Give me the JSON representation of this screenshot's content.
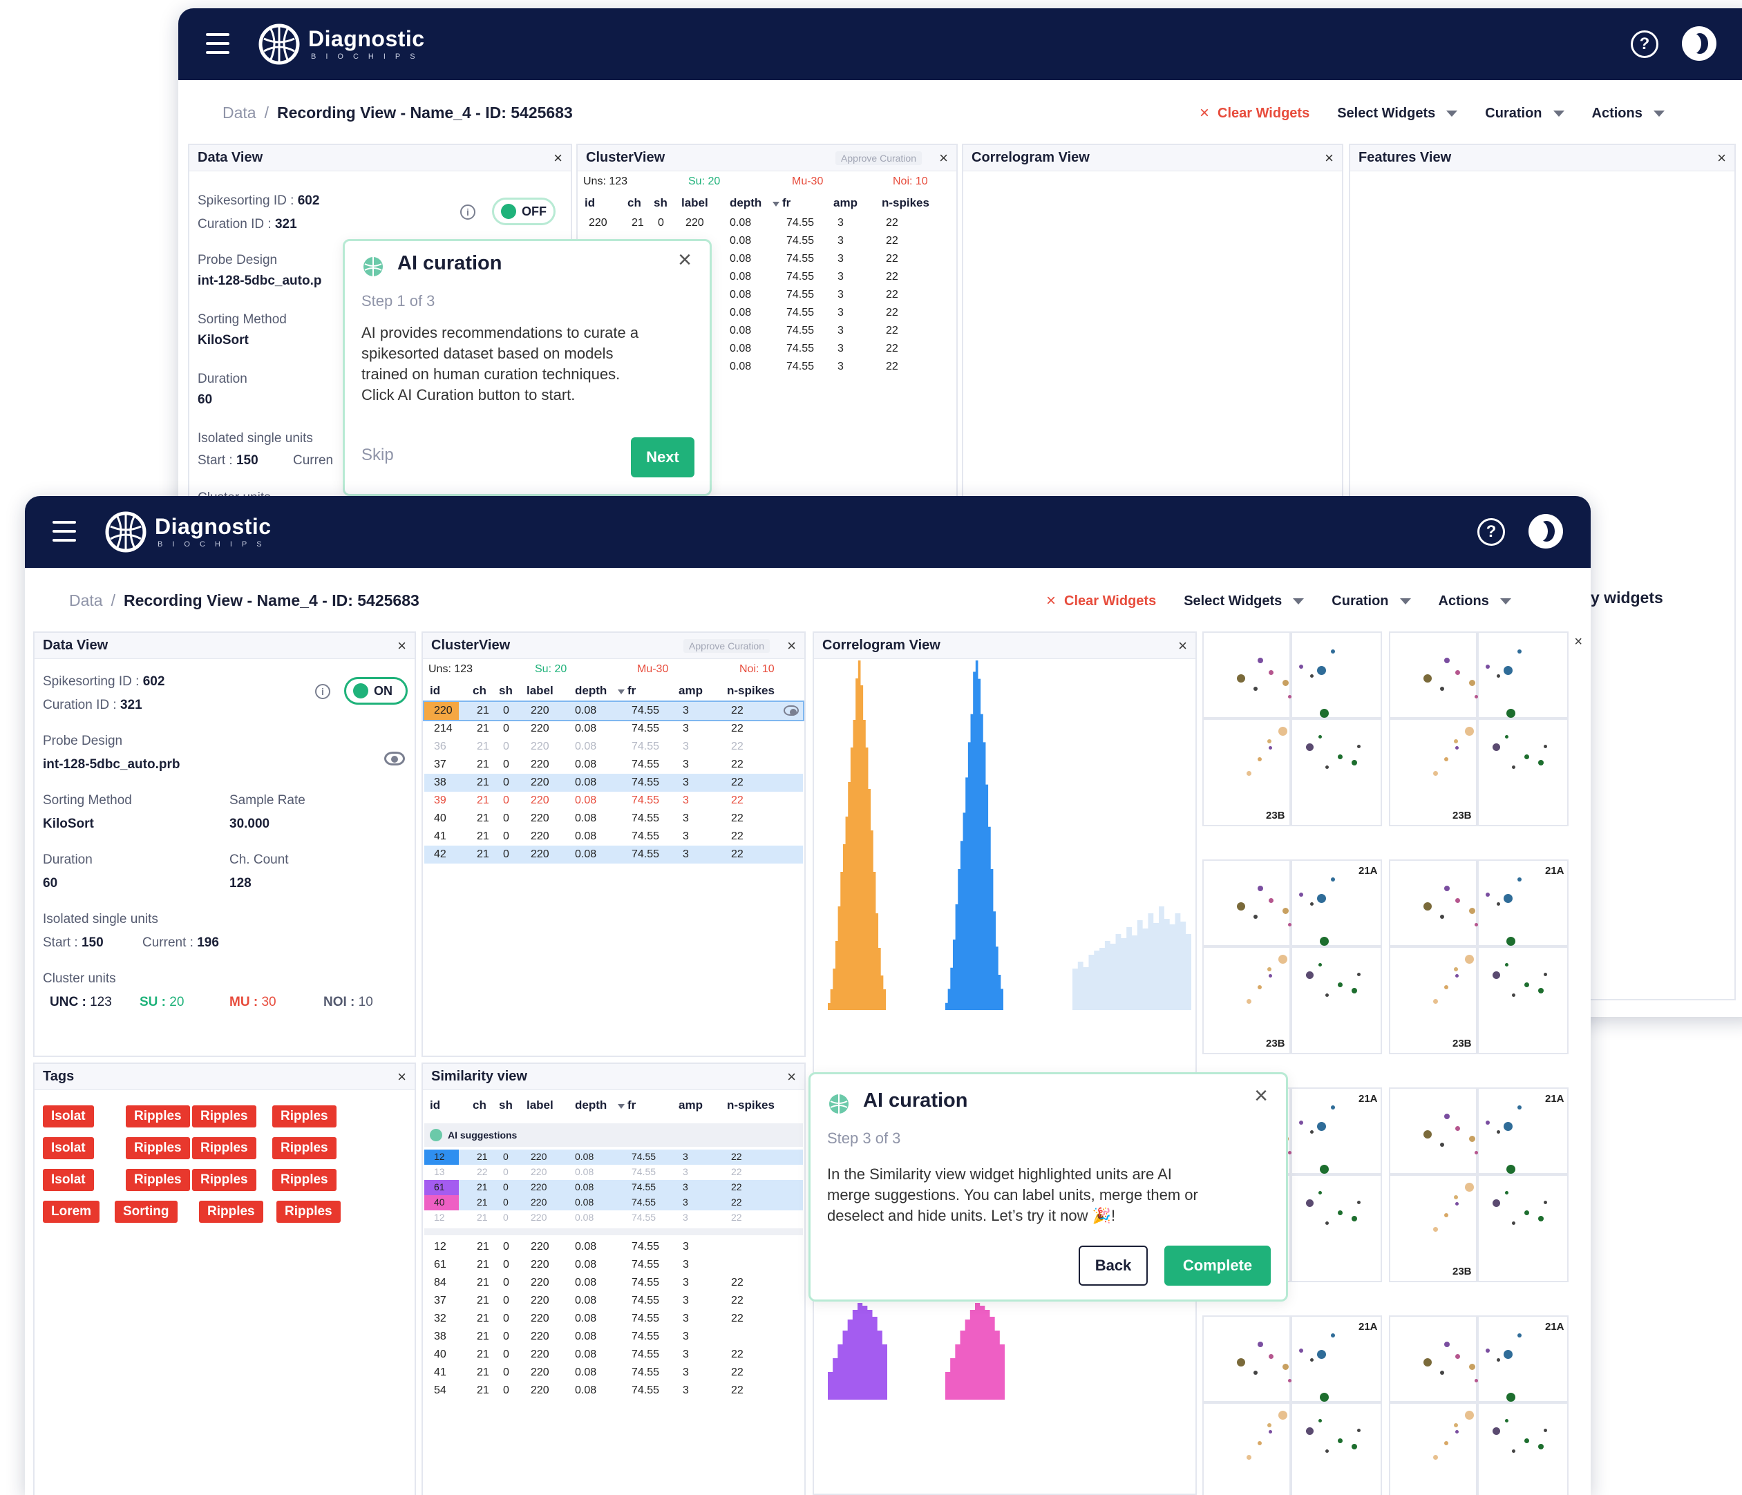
{
  "app": {
    "brand": "Diagnostic",
    "brand_sub": "BIOCHIPS",
    "help_glyph": "?"
  },
  "breadcrumb": {
    "root": "Data",
    "separator": "/",
    "current": "Recording View - Name_4 - ID: 5425683"
  },
  "toolbar": {
    "clear_glyph": "×",
    "clear": "Clear Widgets",
    "select": "Select Widgets",
    "curation": "Curation",
    "actions": "Actions"
  },
  "back_window": {
    "panels": {
      "data_view": "Data View",
      "cluster_view": "ClusterView",
      "correlogram": "Correlogram View",
      "features": "Features View"
    },
    "data_view": {
      "spikesorting_label": "Spikesorting ID :",
      "spikesorting_value": "602",
      "curation_label": "Curation ID :",
      "curation_value": "321",
      "toggle": "OFF",
      "probe_label": "Probe Design",
      "probe_value": "int-128-5dbc_auto.p",
      "sorting_label": "Sorting Method",
      "sorting_value": "KiloSort",
      "duration_label": "Duration",
      "duration_value": "60",
      "isolated_label": "Isolated single units",
      "start_label": "Start :",
      "start_value": "150",
      "current_label": "Curren",
      "cluster_label": "Cluster units"
    },
    "cluster_view": {
      "approve": "Approve Curation",
      "counts": {
        "uns": "Uns: 123",
        "su": "Su: 20",
        "mu": "Mu-30",
        "noi": "Noi: 10"
      },
      "headers": [
        "id",
        "ch",
        "sh",
        "label",
        "depth",
        "fr",
        "amp",
        "n-spikes"
      ],
      "first_row": [
        "220",
        "21",
        "0",
        "220",
        "0.08",
        "74.55",
        "3",
        "22"
      ],
      "repeat_row": [
        "0.08",
        "74.55",
        "3",
        "22"
      ]
    },
    "tour": {
      "title": "AI curation",
      "step": "Step 1 of 3",
      "lines": [
        "AI provides recommendations to curate a",
        "spikesorted dataset based on models",
        "trained on human curation techniques.",
        "Click AI Curation button to start."
      ],
      "close": "×",
      "skip": "Skip",
      "next": "Next"
    }
  },
  "front_window": {
    "side_text": "y widgets",
    "panels": {
      "data_view": "Data View",
      "cluster_view": "ClusterView",
      "correlogram": "Correlogram View",
      "tags": "Tags",
      "similarity": "Similarity view"
    },
    "data_view": {
      "spikesorting_label": "Spikesorting ID :",
      "spikesorting_value": "602",
      "curation_label": "Curation ID :",
      "curation_value": "321",
      "toggle": "ON",
      "info_glyph": "i",
      "probe_label": "Probe Design",
      "probe_value": "int-128-5dbc_auto.prb",
      "sorting_label": "Sorting Method",
      "sorting_value": "KiloSort",
      "rate_label": "Sample Rate",
      "rate_value": "30.000",
      "duration_label": "Duration",
      "duration_value": "60",
      "count_label": "Ch. Count",
      "count_value": "128",
      "isolated_label": "Isolated single units",
      "start_label": "Start :",
      "start_value": "150",
      "current_label": "Current :",
      "current_value": "196",
      "cluster_label": "Cluster units",
      "unc_label": "UNC :",
      "unc_value": "123",
      "su_label": "SU :",
      "su_value": "20",
      "mu_label": "MU :",
      "mu_value": "30",
      "noi_label": "NOI :",
      "noi_value": "10"
    },
    "cluster_view": {
      "approve": "Approve Curation",
      "counts": {
        "uns": "Uns: 123",
        "su": "Su: 20",
        "mu": "Mu-30",
        "noi": "Noi: 10"
      },
      "headers": [
        "id",
        "ch",
        "sh",
        "label",
        "depth",
        "fr",
        "amp",
        "n-spikes"
      ],
      "rows": [
        {
          "cells": [
            "220",
            "21",
            "0",
            "220",
            "0.08",
            "74.55",
            "3",
            "22"
          ],
          "state": "sel-orange"
        },
        {
          "cells": [
            "214",
            "21",
            "0",
            "220",
            "0.08",
            "74.55",
            "3",
            "22"
          ],
          "state": "normal"
        },
        {
          "cells": [
            "36",
            "21",
            "0",
            "220",
            "0.08",
            "74.55",
            "3",
            "22"
          ],
          "state": "dim"
        },
        {
          "cells": [
            "37",
            "21",
            "0",
            "220",
            "0.08",
            "74.55",
            "3",
            "22"
          ],
          "state": "normal"
        },
        {
          "cells": [
            "38",
            "21",
            "0",
            "220",
            "0.08",
            "74.55",
            "3",
            "22"
          ],
          "state": "sel"
        },
        {
          "cells": [
            "39",
            "21",
            "0",
            "220",
            "0.08",
            "74.55",
            "3",
            "22"
          ],
          "state": "red"
        },
        {
          "cells": [
            "40",
            "21",
            "0",
            "220",
            "0.08",
            "74.55",
            "3",
            "22"
          ],
          "state": "normal"
        },
        {
          "cells": [
            "41",
            "21",
            "0",
            "220",
            "0.08",
            "74.55",
            "3",
            "22"
          ],
          "state": "normal"
        },
        {
          "cells": [
            "42",
            "21",
            "0",
            "220",
            "0.08",
            "74.55",
            "3",
            "22"
          ],
          "state": "sel"
        }
      ]
    },
    "similarity": {
      "headers": [
        "id",
        "ch",
        "sh",
        "label",
        "depth",
        "fr",
        "amp",
        "n-spikes"
      ],
      "ai_label": "AI suggestions",
      "ai_rows": [
        {
          "cells": [
            "12",
            "21",
            "0",
            "220",
            "0.08",
            "74.55",
            "3",
            "22"
          ],
          "state": "blue"
        },
        {
          "cells": [
            "13",
            "22",
            "0",
            "220",
            "0.08",
            "74.55",
            "3",
            "22"
          ],
          "state": "dim"
        },
        {
          "cells": [
            "61",
            "21",
            "0",
            "220",
            "0.08",
            "74.55",
            "3",
            "22"
          ],
          "state": "purple"
        },
        {
          "cells": [
            "40",
            "21",
            "0",
            "220",
            "0.08",
            "74.55",
            "3",
            "22"
          ],
          "state": "pink"
        },
        {
          "cells": [
            "12",
            "21",
            "0",
            "220",
            "0.08",
            "74.55",
            "3",
            "22"
          ],
          "state": "dim"
        }
      ],
      "rows": [
        [
          "12",
          "21",
          "0",
          "220",
          "0.08",
          "74.55",
          "3",
          ""
        ],
        [
          "61",
          "21",
          "0",
          "220",
          "0.08",
          "74.55",
          "3",
          ""
        ],
        [
          "84",
          "21",
          "0",
          "220",
          "0.08",
          "74.55",
          "3",
          "22"
        ],
        [
          "37",
          "21",
          "0",
          "220",
          "0.08",
          "74.55",
          "3",
          "22"
        ],
        [
          "32",
          "21",
          "0",
          "220",
          "0.08",
          "74.55",
          "3",
          "22"
        ],
        [
          "38",
          "21",
          "0",
          "220",
          "0.08",
          "74.55",
          "3",
          ""
        ],
        [
          "40",
          "21",
          "0",
          "220",
          "0.08",
          "74.55",
          "3",
          "22"
        ],
        [
          "41",
          "21",
          "0",
          "220",
          "0.08",
          "74.55",
          "3",
          "22"
        ],
        [
          "54",
          "21",
          "0",
          "220",
          "0.08",
          "74.55",
          "3",
          "22"
        ]
      ]
    },
    "tags": [
      [
        "Isolat",
        "Ripples",
        "Ripples",
        "Ripples"
      ],
      [
        "Isolat",
        "Ripples",
        "Ripples",
        "Ripples"
      ],
      [
        "Isolat",
        "Ripples",
        "Ripples",
        "Ripples"
      ],
      [
        "Lorem",
        "Sorting",
        "Ripples",
        "Ripples"
      ]
    ],
    "features": {
      "labels_top": [
        "",
        "",
        "21A",
        "21A",
        "21A",
        "21A",
        "21A",
        "21A"
      ],
      "labels_bottom": [
        "23B",
        "23B",
        "23B",
        "23B",
        "",
        "23B",
        "",
        ""
      ]
    },
    "tour": {
      "title": "AI curation",
      "step": "Step 3 of 3",
      "lines": [
        "In the Similarity view widget highlighted units are AI",
        "merge suggestions. You can label units, merge them or",
        "deselect and hide units. Let’s try it now 🎉!"
      ],
      "close": "×",
      "back": "Back",
      "complete": "Complete"
    }
  },
  "colors": {
    "topbar": "#0d1a45",
    "accent": "#1fb27a",
    "danger": "#e8382d",
    "su": "#1fb27a",
    "mu": "#e74c3c",
    "hist_orange": "#f5a742",
    "hist_blue": "#2f8ff0",
    "hist_purple": "#a45cf0",
    "hist_pink": "#ee5fc4"
  }
}
